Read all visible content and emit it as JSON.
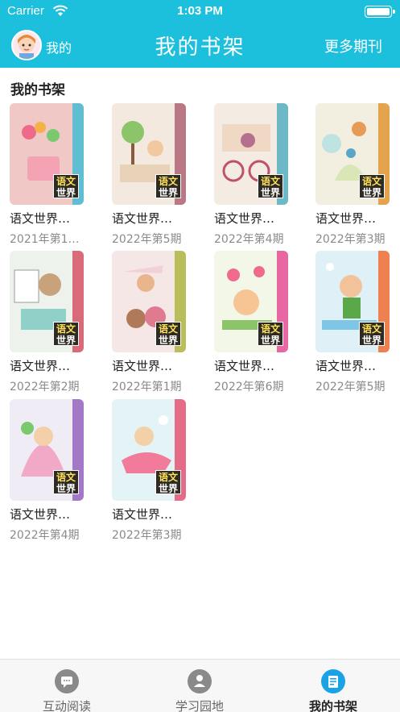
{
  "status_bar": {
    "carrier": "Carrier",
    "time": "1:03 PM"
  },
  "header": {
    "me_label": "我的",
    "title": "我的书架",
    "more": "更多期刊"
  },
  "section": {
    "title": "我的书架"
  },
  "books": [
    {
      "title": "语文世界…",
      "issue": "2021年第1…",
      "bg": "#f0c9c6",
      "band": "#4fbcd3",
      "logo_top": "语文",
      "logo_bottom": "世界"
    },
    {
      "title": "语文世界…",
      "issue": "2022年第5期",
      "bg": "#f3e9df",
      "band": "#b46a7a",
      "logo_top": "语文",
      "logo_bottom": "世界"
    },
    {
      "title": "语文世界…",
      "issue": "2022年第4期",
      "bg": "#f4ece3",
      "band": "#5db3c2",
      "logo_top": "语文",
      "logo_bottom": "世界"
    },
    {
      "title": "语文世界…",
      "issue": "2022年第3期",
      "bg": "#f2efe0",
      "band": "#e29a3c",
      "logo_top": "语文",
      "logo_bottom": "世界"
    },
    {
      "title": "语文世界…",
      "issue": "2022年第2期",
      "bg": "#eef2ec",
      "band": "#d65b6b",
      "logo_top": "语文",
      "logo_bottom": "世界"
    },
    {
      "title": "语文世界…",
      "issue": "2022年第1期",
      "bg": "#f6e7e7",
      "band": "#b2b84a",
      "logo_top": "语文",
      "logo_bottom": "世界"
    },
    {
      "title": "语文世界…",
      "issue": "2022年第6期",
      "bg": "#f2f7e8",
      "band": "#e6579a",
      "logo_top": "语文",
      "logo_bottom": "世界"
    },
    {
      "title": "语文世界…",
      "issue": "2022年第5期",
      "bg": "#dff1f7",
      "band": "#f0743c",
      "logo_top": "语文",
      "logo_bottom": "世界"
    },
    {
      "title": "语文世界…",
      "issue": "2022年第4期",
      "bg": "#f0ecf6",
      "band": "#9a6bc2",
      "logo_top": "语文",
      "logo_bottom": "世界"
    },
    {
      "title": "语文世界…",
      "issue": "2022年第3期",
      "bg": "#e4f3f6",
      "band": "#e35d7a",
      "logo_top": "语文",
      "logo_bottom": "世界"
    }
  ],
  "tabbar": {
    "tabs": [
      {
        "label": "互动阅读",
        "icon": "chat-bubble-icon",
        "active": false
      },
      {
        "label": "学习园地",
        "icon": "person-book-icon",
        "active": false
      },
      {
        "label": "我的书架",
        "icon": "bookshelf-icon",
        "active": true
      }
    ]
  },
  "colors": {
    "header": "#1cc0dc",
    "active_tab": "#1aa2e6",
    "inactive_tab": "#8a8a8a"
  }
}
